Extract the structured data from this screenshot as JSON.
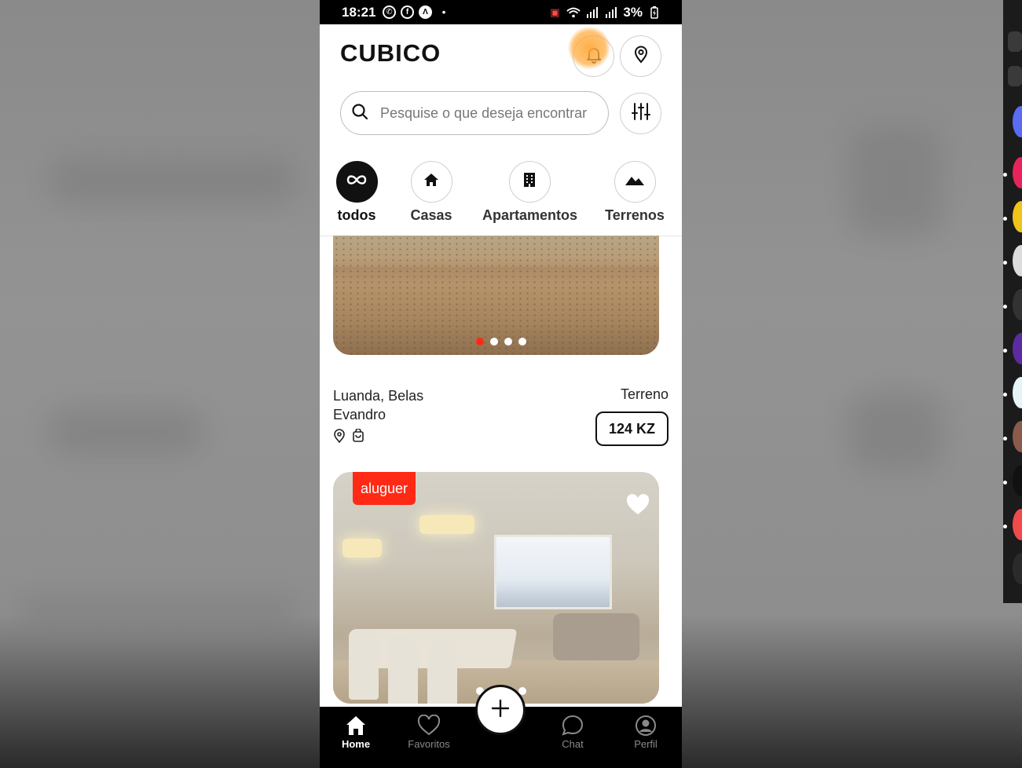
{
  "status_bar": {
    "time": "18:21",
    "battery": "3%"
  },
  "app": {
    "brand": "CUBICO"
  },
  "search": {
    "placeholder": "Pesquise o que deseja encontrar"
  },
  "categories": [
    {
      "label": "todos",
      "icon": "infinity-icon",
      "active": true
    },
    {
      "label": "Casas",
      "icon": "house-icon",
      "active": false
    },
    {
      "label": "Apartamentos",
      "icon": "building-icon",
      "active": false
    },
    {
      "label": "Terrenos",
      "icon": "mountain-icon",
      "active": false
    }
  ],
  "listings": [
    {
      "location": "Luanda, Belas",
      "owner": "Evandro",
      "type": "Terreno",
      "price": "124 KZ",
      "carousel": {
        "count": 4,
        "active_index": 0
      }
    },
    {
      "tag": "aluguer",
      "carousel": {
        "count": 4,
        "active_index": 0
      }
    }
  ],
  "bottom_nav": [
    {
      "label": "Home",
      "icon": "home-icon",
      "active": true
    },
    {
      "label": "Favoritos",
      "icon": "heart-icon",
      "active": false
    },
    {
      "label": "Chat",
      "icon": "chat-icon",
      "active": false
    },
    {
      "label": "Perfil",
      "icon": "profile-icon",
      "active": false
    }
  ],
  "colors": {
    "accent": "#ff2a16",
    "notification_highlight": "#ffaa3c",
    "nav_background": "#000000"
  }
}
